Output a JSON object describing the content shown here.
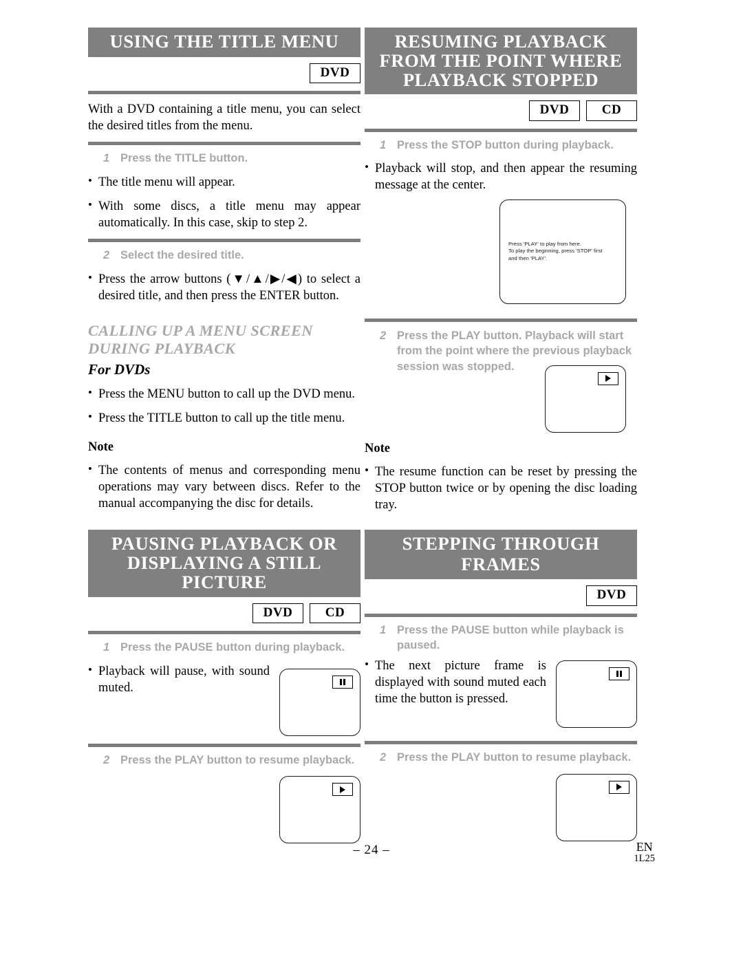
{
  "page": {
    "number": "– 24 –",
    "lang_code": "EN",
    "doc_code": "1L25"
  },
  "colors": {
    "banner_bg": "#808080",
    "banner_text": "#ffffff",
    "rule": "#7d7d7d",
    "step_text": "#a8a8a8",
    "body_text": "#000000"
  },
  "left_column": {
    "section1": {
      "banner": "USING THE TITLE MENU",
      "badges": [
        "DVD"
      ],
      "intro": "With a DVD containing a title menu, you can select the desired titles from the menu.",
      "step1": {
        "num": "1",
        "text": "Press the TITLE button."
      },
      "step1_bullets": [
        "The title menu will appear.",
        "With some discs, a title menu may appear automatically. In this case, skip to step 2."
      ],
      "step2": {
        "num": "2",
        "text": "Select the desired title."
      },
      "step2_bullets": [
        "Press the arrow buttons (▼/▲/▶/◀) to select a desired title, and then press the ENTER button."
      ],
      "subhead": "CALLING UP A MENU SCREEN DURING PLAYBACK",
      "subsubhead": "For DVDs",
      "sub_bullets": [
        "Press the MENU button to call up the DVD menu.",
        "Press the TITLE button to call up the title menu."
      ],
      "note_label": "Note",
      "note_bullets": [
        "The contents of menus and corresponding menu operations may vary between discs. Refer to the manual accompanying the disc for details."
      ]
    },
    "section2": {
      "banner": "PAUSING PLAYBACK OR DISPLAYING A STILL PICTURE",
      "badges": [
        "DVD",
        "CD"
      ],
      "step1": {
        "num": "1",
        "text": "Press the PAUSE button during playback."
      },
      "step1_bullets": [
        "Playback will pause, with sound muted."
      ],
      "step1_screen_icon": "pause-icon",
      "step2": {
        "num": "2",
        "text": "Press the PLAY button to resume playback."
      },
      "step2_screen_icon": "play-icon"
    }
  },
  "right_column": {
    "section1": {
      "banner": "RESUMING PLAYBACK FROM THE POINT WHERE PLAYBACK STOPPED",
      "badges": [
        "DVD",
        "CD"
      ],
      "step1": {
        "num": "1",
        "text": "Press the STOP button during playback."
      },
      "step1_bullets": [
        "Playback will stop, and then appear the resuming message at the center."
      ],
      "screen_message": [
        "Press 'PLAY' to play from here.",
        "To play the beginning, press 'STOP' first",
        "and then 'PLAY'."
      ],
      "step2": {
        "num": "2",
        "text": "Press the PLAY button. Playback will start from the point where the previous playback session was stopped."
      },
      "step2_screen_icon": "play-icon",
      "note_label": "Note",
      "note_bullets": [
        "The resume function can be reset by pressing the STOP button twice or by opening the disc loading tray."
      ]
    },
    "section2": {
      "banner": "STEPPING THROUGH FRAMES",
      "badges": [
        "DVD"
      ],
      "step1": {
        "num": "1",
        "text": "Press the PAUSE button while playback is paused."
      },
      "step1_bullets": [
        "The next picture frame is displayed with sound muted each time the button is pressed."
      ],
      "step1_screen_icon": "pause-icon",
      "step2": {
        "num": "2",
        "text": "Press the PLAY button to resume playback."
      },
      "step2_screen_icon": "play-icon"
    }
  }
}
